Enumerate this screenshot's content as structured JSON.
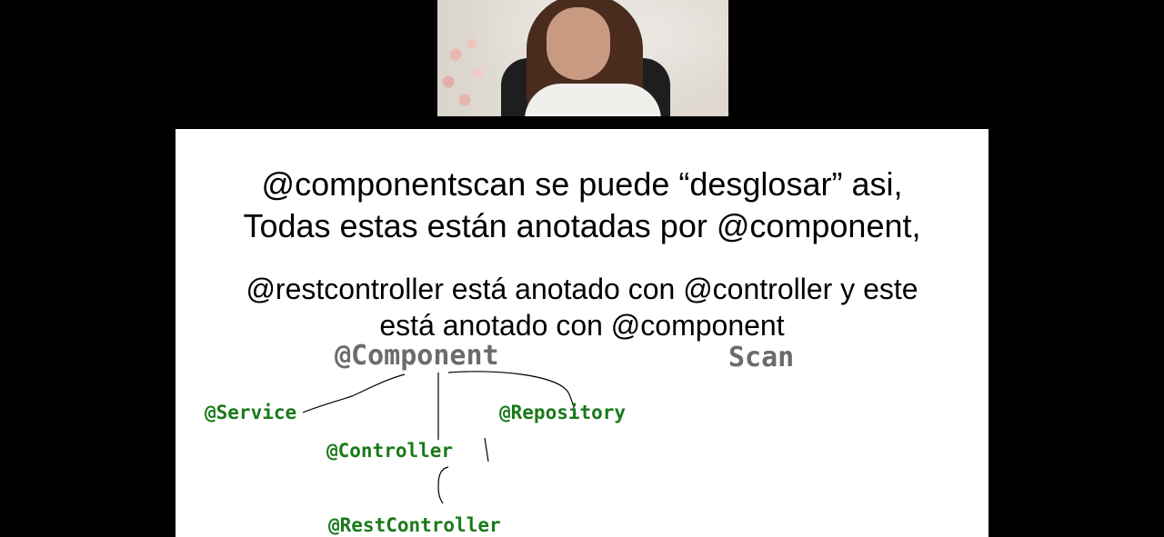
{
  "slide": {
    "title_line_1": "@componentscan se puede “desglosar” asi,",
    "title_line_2": "Todas estas están anotadas por @component,",
    "body_line_1": "@restcontroller está anotado con @controller y este",
    "body_line_2": "está anotado con @component"
  },
  "diagram": {
    "root": "@Component",
    "root_suffix": "Scan",
    "children": [
      "@Service",
      "@Controller",
      "@Repository"
    ],
    "grandchild": "@RestController"
  },
  "colors": {
    "background": "#000000",
    "slide_background": "#ffffff",
    "root_text": "#6b6b6b",
    "node_text": "#1a7a1a",
    "ink": "#000000"
  }
}
